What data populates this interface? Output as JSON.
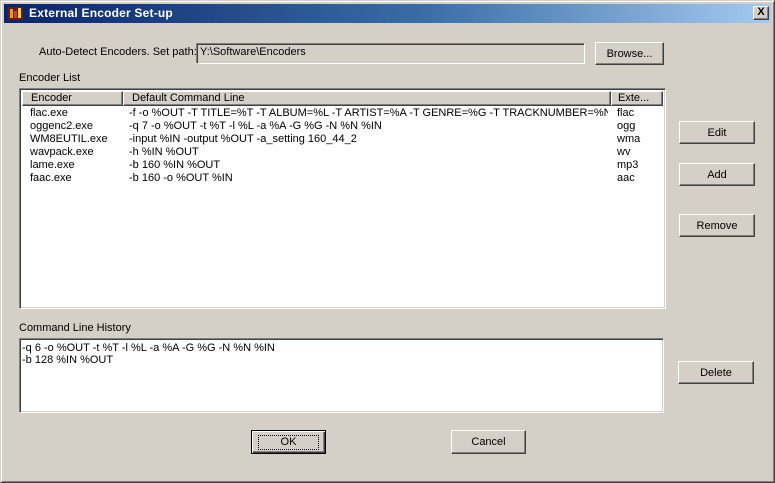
{
  "window": {
    "title": "External Encoder Set-up",
    "close_label": "X"
  },
  "autodetect": {
    "label": "Auto-Detect Encoders. Set path:",
    "path": "Y:\\Software\\Encoders",
    "browse_label": "Browse..."
  },
  "encoder_list": {
    "label": "Encoder List",
    "columns": [
      "Encoder",
      "Default Command Line",
      "Exte..."
    ],
    "rows": [
      {
        "encoder": "flac.exe",
        "command": "-f -o %OUT -T TITLE=%T -T ALBUM=%L -T ARTIST=%A -T GENRE=%G -T TRACKNUMBER=%N ...",
        "ext": "flac"
      },
      {
        "encoder": "oggenc2.exe",
        "command": "-q 7 -o %OUT -t %T -l %L -a %A -G %G -N %N %IN",
        "ext": "ogg"
      },
      {
        "encoder": "WM8EUTIL.exe",
        "command": "-input %IN -output %OUT -a_setting 160_44_2",
        "ext": "wma"
      },
      {
        "encoder": "wavpack.exe",
        "command": "-h %IN %OUT",
        "ext": "wv"
      },
      {
        "encoder": "lame.exe",
        "command": "-b 160 %IN %OUT",
        "ext": "mp3"
      },
      {
        "encoder": "faac.exe",
        "command": "-b 160 -o %OUT %IN",
        "ext": "aac"
      }
    ]
  },
  "side_buttons": {
    "edit": "Edit",
    "add": "Add",
    "remove": "Remove",
    "delete": "Delete"
  },
  "history": {
    "label": "Command Line History",
    "lines": [
      "-q 6 -o %OUT -t %T -l %L -a %A -G %G -N %N %IN",
      "-b 128 %IN %OUT"
    ]
  },
  "footer": {
    "ok": "OK",
    "cancel": "Cancel"
  }
}
